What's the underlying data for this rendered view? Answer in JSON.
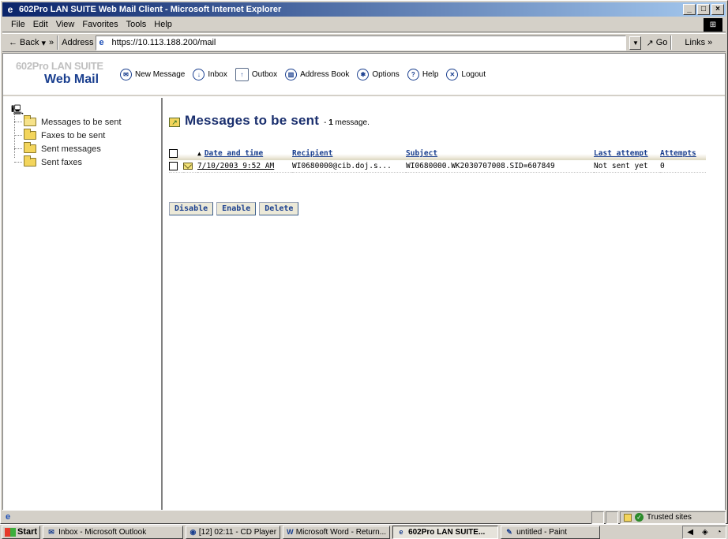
{
  "window": {
    "title": "602Pro LAN SUITE Web Mail Client - Microsoft Internet Explorer",
    "controls": [
      "_",
      "□",
      "×"
    ]
  },
  "menubar": {
    "items": [
      "File",
      "Edit",
      "View",
      "Favorites",
      "Tools",
      "Help"
    ]
  },
  "addressbar": {
    "back_label": "Back",
    "chevron": "»",
    "address_label": "Address",
    "url": "https://10.113.188.200/mail",
    "go_label": "Go",
    "links_label": "Links"
  },
  "webmail": {
    "logo_top": "602Pro LAN SUITE",
    "logo_bottom": "Web Mail",
    "nav": [
      {
        "label": "New Message",
        "icon": "new-message-icon"
      },
      {
        "label": "Inbox",
        "icon": "inbox-icon"
      },
      {
        "label": "Outbox",
        "icon": "outbox-icon"
      },
      {
        "label": "Address Book",
        "icon": "address-book-icon"
      },
      {
        "label": "Options",
        "icon": "options-icon"
      },
      {
        "label": "Help",
        "icon": "help-icon"
      },
      {
        "label": "Logout",
        "icon": "logout-icon"
      }
    ]
  },
  "tree": {
    "items": [
      {
        "label": "Messages to be sent",
        "open": true
      },
      {
        "label": "Faxes to be sent",
        "open": false
      },
      {
        "label": "Sent messages",
        "open": false
      },
      {
        "label": "Sent faxes",
        "open": false
      }
    ]
  },
  "main": {
    "title": "Messages to be sent",
    "count_prefix": " - ",
    "count": "1",
    "count_suffix": " message.",
    "columns": [
      "Date and time",
      "Recipient",
      "Subject",
      "Last attempt",
      "Attempts"
    ],
    "rows": [
      {
        "date": "7/10/2003 9:52 AM",
        "recipient": "WI0680000@cib.doj.s...",
        "subject": "WI0680000.WK2030707008.SID=607849",
        "last_attempt": "Not sent yet",
        "attempts": "0"
      }
    ],
    "buttons": [
      "Disable",
      "Enable",
      "Delete"
    ]
  },
  "statusbar": {
    "zone": "Trusted sites"
  },
  "taskbar": {
    "start": "Start",
    "tasks": [
      {
        "label": "Inbox - Microsoft Outlook",
        "active": false
      },
      {
        "label": "[12] 02:11 - CD Player",
        "active": false
      },
      {
        "label": "Microsoft Word - Return...",
        "active": false
      },
      {
        "label": "602Pro LAN SUITE...",
        "active": true
      },
      {
        "label": "untitled - Paint",
        "active": false
      }
    ]
  }
}
